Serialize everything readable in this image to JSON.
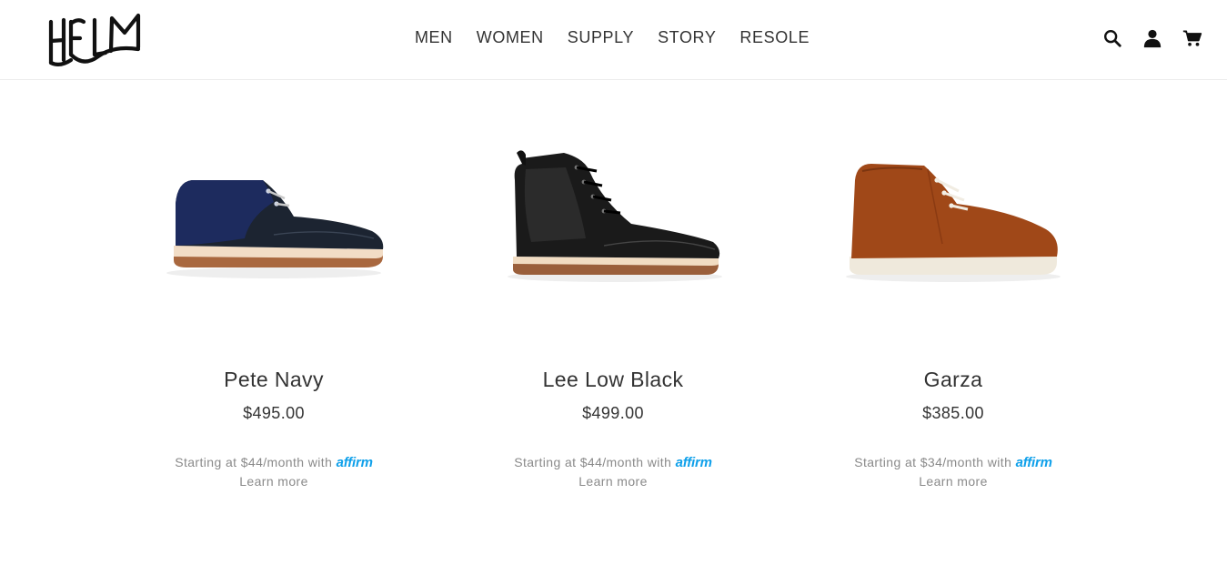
{
  "brand": {
    "logo_text": "HELM",
    "logo_color": "#111111"
  },
  "nav": {
    "items": [
      {
        "label": "MEN"
      },
      {
        "label": "WOMEN"
      },
      {
        "label": "SUPPLY"
      },
      {
        "label": "STORY"
      },
      {
        "label": "RESOLE"
      }
    ]
  },
  "header_icons": [
    "search-icon",
    "account-icon",
    "cart-icon"
  ],
  "products": [
    {
      "name": "Pete Navy",
      "price": "$495.00",
      "financing_prefix": "Starting at $44/month with",
      "financing_brand": "affirm",
      "learn_more": "Learn more",
      "image": "navy suede chukka boot"
    },
    {
      "name": "Lee Low Black",
      "price": "$499.00",
      "financing_prefix": "Starting at $44/month with",
      "financing_brand": "affirm",
      "learn_more": "Learn more",
      "image": "black leather lace-up boot"
    },
    {
      "name": "Garza",
      "price": "$385.00",
      "financing_prefix": "Starting at $34/month with",
      "financing_brand": "affirm",
      "learn_more": "Learn more",
      "image": "rust suede desert boot"
    }
  ],
  "colors": {
    "affirm": "#0fa0ea",
    "text": "#333333",
    "muted": "#8a8a8a"
  }
}
